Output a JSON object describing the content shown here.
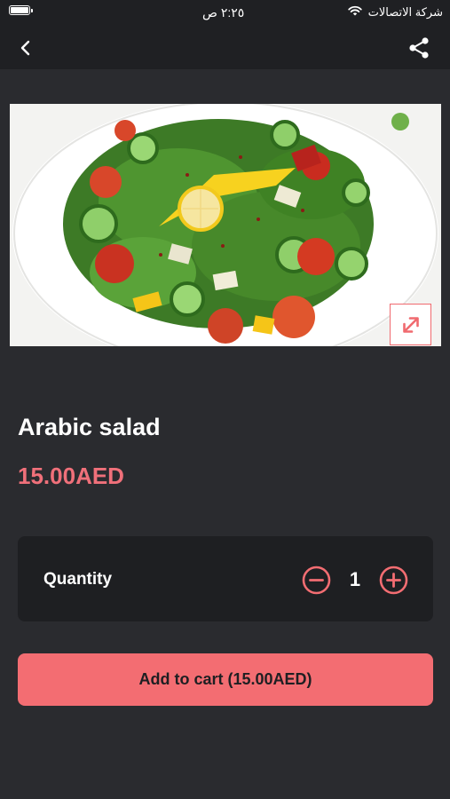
{
  "status_bar": {
    "carrier": "شركة الاتصالات",
    "time": "٢:٢٥ ص"
  },
  "nav": {
    "back_icon": "chevron-left-icon",
    "share_icon": "share-icon"
  },
  "product": {
    "name": "Arabic salad",
    "price": "15.00AED",
    "image_desc": "salad-photo",
    "expand_icon": "expand-icon"
  },
  "quantity": {
    "label": "Quantity",
    "value": "1",
    "minus_icon": "minus-circle-icon",
    "plus_icon": "plus-circle-icon"
  },
  "cart": {
    "button_label": "Add to cart (15.00AED)"
  },
  "colors": {
    "accent": "#f36d72",
    "background": "#2a2b2f",
    "card": "#1e1f22"
  }
}
